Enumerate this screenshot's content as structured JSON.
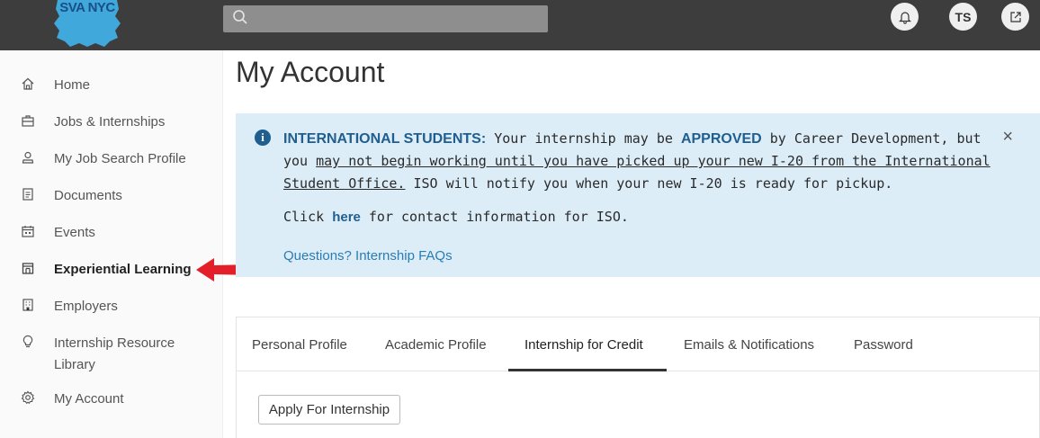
{
  "header": {
    "logo_text": "SVA NYC",
    "search_placeholder": "",
    "avatar_initials": "TS",
    "icons": [
      "search-icon",
      "bell-icon",
      "external-link-icon"
    ]
  },
  "sidebar": {
    "items": [
      {
        "label": "Home",
        "icon": "home-icon"
      },
      {
        "label": "Jobs & Internships",
        "icon": "briefcase-icon"
      },
      {
        "label": "My Job Search Profile",
        "icon": "person-icon"
      },
      {
        "label": "Documents",
        "icon": "document-icon"
      },
      {
        "label": "Events",
        "icon": "calendar-icon"
      },
      {
        "label": "Experiential Learning",
        "icon": "experiential-icon",
        "active": true
      },
      {
        "label": "Employers",
        "icon": "building-icon"
      },
      {
        "label": "Internship Resource Library",
        "icon": "lightbulb-icon"
      },
      {
        "label": "My Account",
        "icon": "gear-icon"
      }
    ]
  },
  "main": {
    "title": "My Account",
    "banner": {
      "strong_label": "INTERNATIONAL STUDENTS:",
      "text_1": " Your internship may be ",
      "approved": "APPROVED",
      "text_2": " by Career Development, but you ",
      "underlined": "may not begin working until you have picked up your new I-20 from the International Student Office.",
      "text_3": " ISO will notify you when your new I-20 is ready for pickup.",
      "click_prefix": "Click ",
      "here": "here",
      "click_suffix": " for contact information for ISO.",
      "faq_link": "Questions? Internship FAQs",
      "close": "×"
    },
    "tabs": [
      {
        "label": "Personal Profile"
      },
      {
        "label": "Academic Profile"
      },
      {
        "label": "Internship for Credit",
        "active": true
      },
      {
        "label": "Emails & Notifications"
      },
      {
        "label": "Password"
      }
    ],
    "apply_button": "Apply For Internship"
  },
  "colors": {
    "topbar": "#3d3d3d",
    "banner_bg": "#dcedf8",
    "accent_blue": "#1f5e8f",
    "link_blue": "#2a7cb3",
    "arrow_red": "#e3202a",
    "logo_blue": "#41a8dc"
  }
}
